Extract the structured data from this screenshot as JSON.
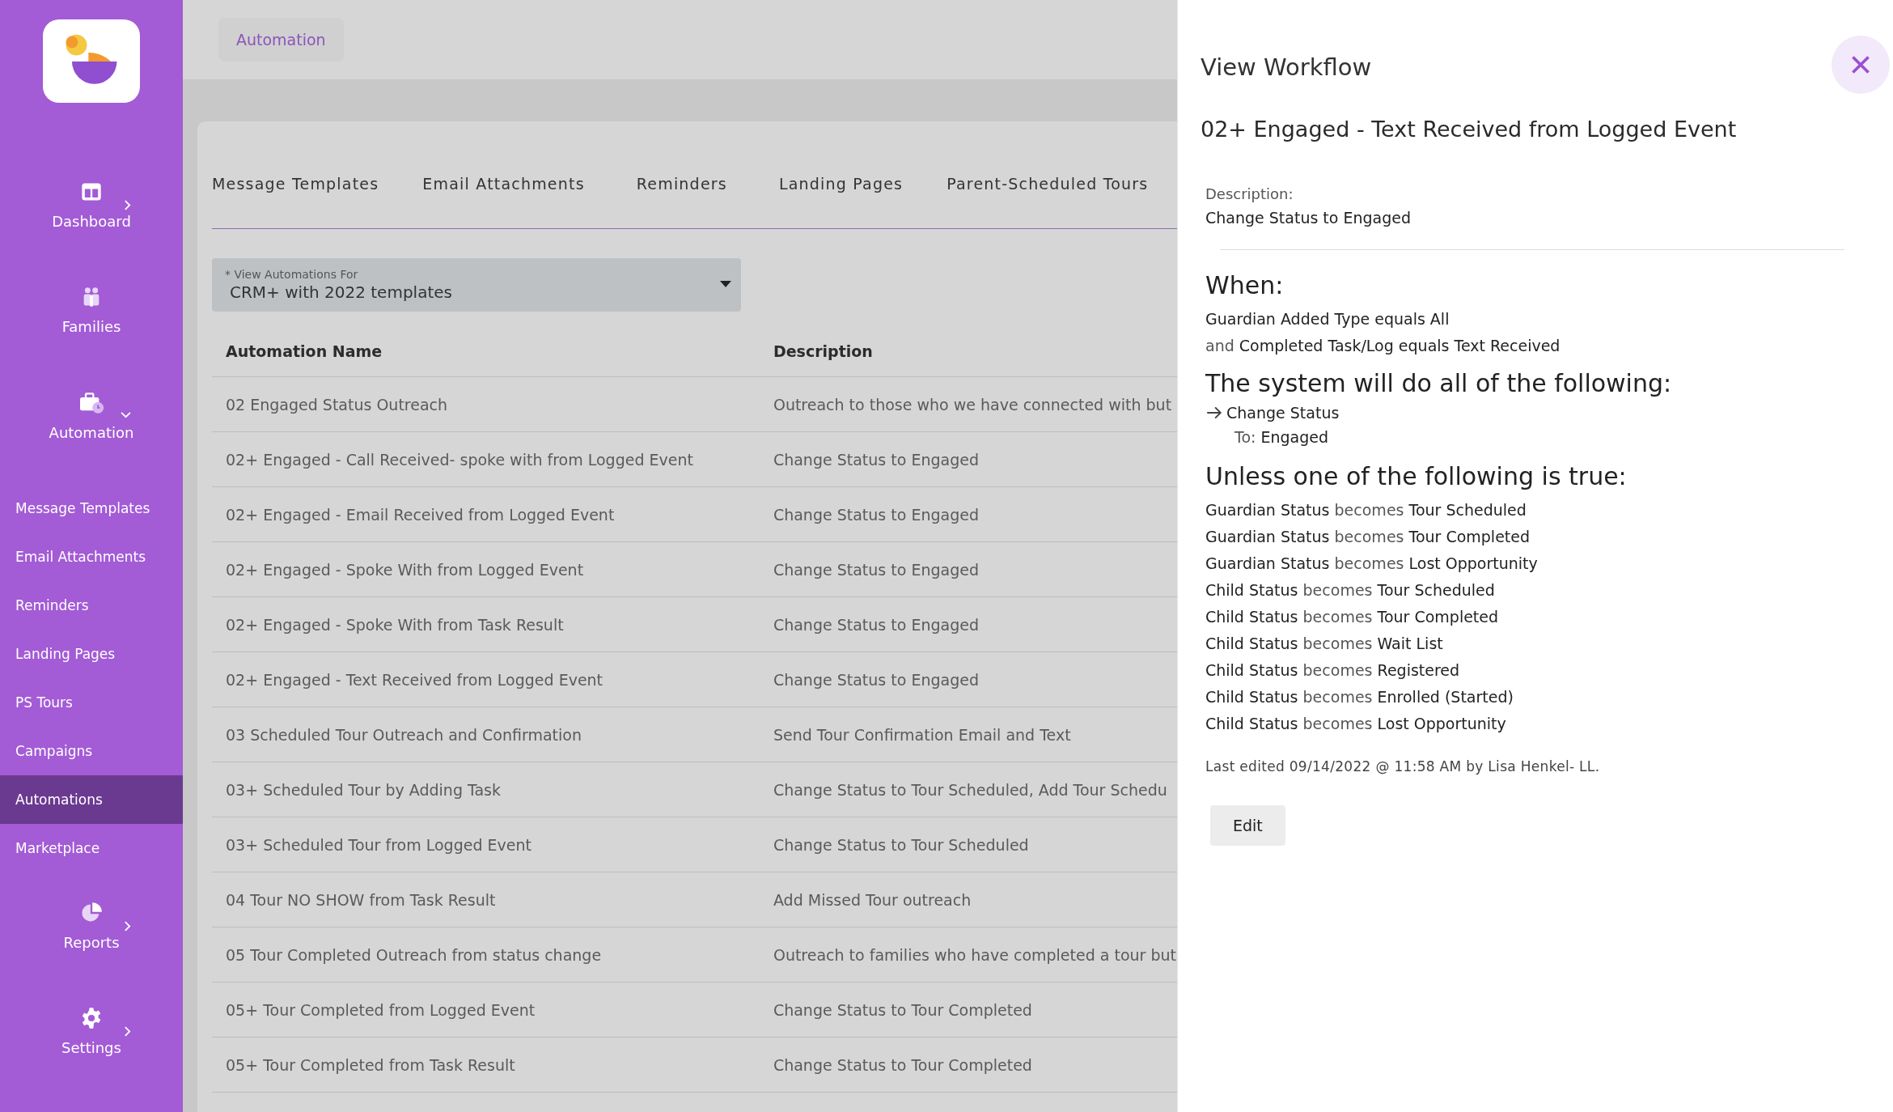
{
  "sidebar": {
    "nav_items": [
      {
        "label": "Dashboard",
        "kind": "collapsed"
      },
      {
        "label": "Families",
        "kind": "plain"
      },
      {
        "label": "Automation",
        "kind": "expanded"
      }
    ],
    "sub_items": [
      {
        "label": "Message Templates",
        "selected": false
      },
      {
        "label": "Email Attachments",
        "selected": false
      },
      {
        "label": "Reminders",
        "selected": false
      },
      {
        "label": "Landing Pages",
        "selected": false
      },
      {
        "label": "PS Tours",
        "selected": false
      },
      {
        "label": "Campaigns",
        "selected": false
      },
      {
        "label": "Automations",
        "selected": true
      },
      {
        "label": "Marketplace",
        "selected": false
      }
    ],
    "bottom_items": [
      {
        "label": "Reports",
        "kind": "collapsed"
      },
      {
        "label": "Settings",
        "kind": "collapsed"
      }
    ]
  },
  "breadcrumb": "Automation",
  "tabs": [
    "Message Templates",
    "Email Attachments",
    "Reminders",
    "Landing Pages",
    "Parent-Scheduled Tours"
  ],
  "filter": {
    "label": "* View Automations For",
    "value": "CRM+ with 2022 templates"
  },
  "table": {
    "columns": [
      "Automation Name",
      "Description"
    ],
    "rows": [
      {
        "name": "02 Engaged Status Outreach",
        "description": "Outreach to those who we have connected with but"
      },
      {
        "name": "02+ Engaged - Call Received- spoke with from Logged Event",
        "description": "Change Status to Engaged"
      },
      {
        "name": "02+ Engaged - Email Received from Logged Event",
        "description": "Change Status to Engaged"
      },
      {
        "name": "02+ Engaged - Spoke With from Logged Event",
        "description": "Change Status to Engaged"
      },
      {
        "name": "02+ Engaged - Spoke With from Task Result",
        "description": "Change Status to Engaged"
      },
      {
        "name": "02+ Engaged - Text Received from Logged Event",
        "description": "Change Status to Engaged"
      },
      {
        "name": "03 Scheduled Tour Outreach and Confirmation",
        "description": "Send Tour Confirmation Email and Text"
      },
      {
        "name": "03+ Scheduled Tour by Adding Task",
        "description": "Change Status to Tour Scheduled, Add Tour Schedu"
      },
      {
        "name": "03+ Scheduled Tour from Logged Event",
        "description": "Change Status to Tour Scheduled"
      },
      {
        "name": "04 Tour NO SHOW from Task Result",
        "description": "Add Missed Tour outreach"
      },
      {
        "name": "05 Tour Completed Outreach from status change",
        "description": "Outreach to families who have completed a tour but"
      },
      {
        "name": "05+ Tour Completed from Logged Event",
        "description": "Change Status to Tour Completed"
      },
      {
        "name": "05+ Tour Completed from Task Result",
        "description": "Change Status to Tour Completed"
      }
    ]
  },
  "panel": {
    "title": "View Workflow",
    "name": "02+ Engaged - Text Received from Logged Event",
    "description_label": "Description:",
    "description": "Change Status to Engaged",
    "when_heading": "When:",
    "conditions": [
      {
        "text": "Guardian Added Type equals All"
      },
      {
        "prefix": "and",
        "text": "Completed Task/Log equals Text Received"
      }
    ],
    "actions_heading": "The system will do all of the following:",
    "actions": [
      {
        "name": "Change Status",
        "to_label": "To:",
        "to_value": "Engaged"
      }
    ],
    "unless_heading": "Unless one of the following is true:",
    "exceptions": [
      {
        "field": "Guardian Status",
        "verb": "becomes",
        "value": "Tour Scheduled"
      },
      {
        "field": "Guardian Status",
        "verb": "becomes",
        "value": "Tour Completed"
      },
      {
        "field": "Guardian Status",
        "verb": "becomes",
        "value": "Lost Opportunity"
      },
      {
        "field": "Child Status",
        "verb": "becomes",
        "value": "Tour Scheduled"
      },
      {
        "field": "Child Status",
        "verb": "becomes",
        "value": "Tour Completed"
      },
      {
        "field": "Child Status",
        "verb": "becomes",
        "value": "Wait List"
      },
      {
        "field": "Child Status",
        "verb": "becomes",
        "value": "Registered"
      },
      {
        "field": "Child Status",
        "verb": "becomes",
        "value": "Enrolled (Started)"
      },
      {
        "field": "Child Status",
        "verb": "becomes",
        "value": "Lost Opportunity"
      }
    ],
    "last_edited": "Last edited 09/14/2022 @ 11:58 AM by Lisa Henkel- LL.",
    "edit_button": "Edit"
  }
}
